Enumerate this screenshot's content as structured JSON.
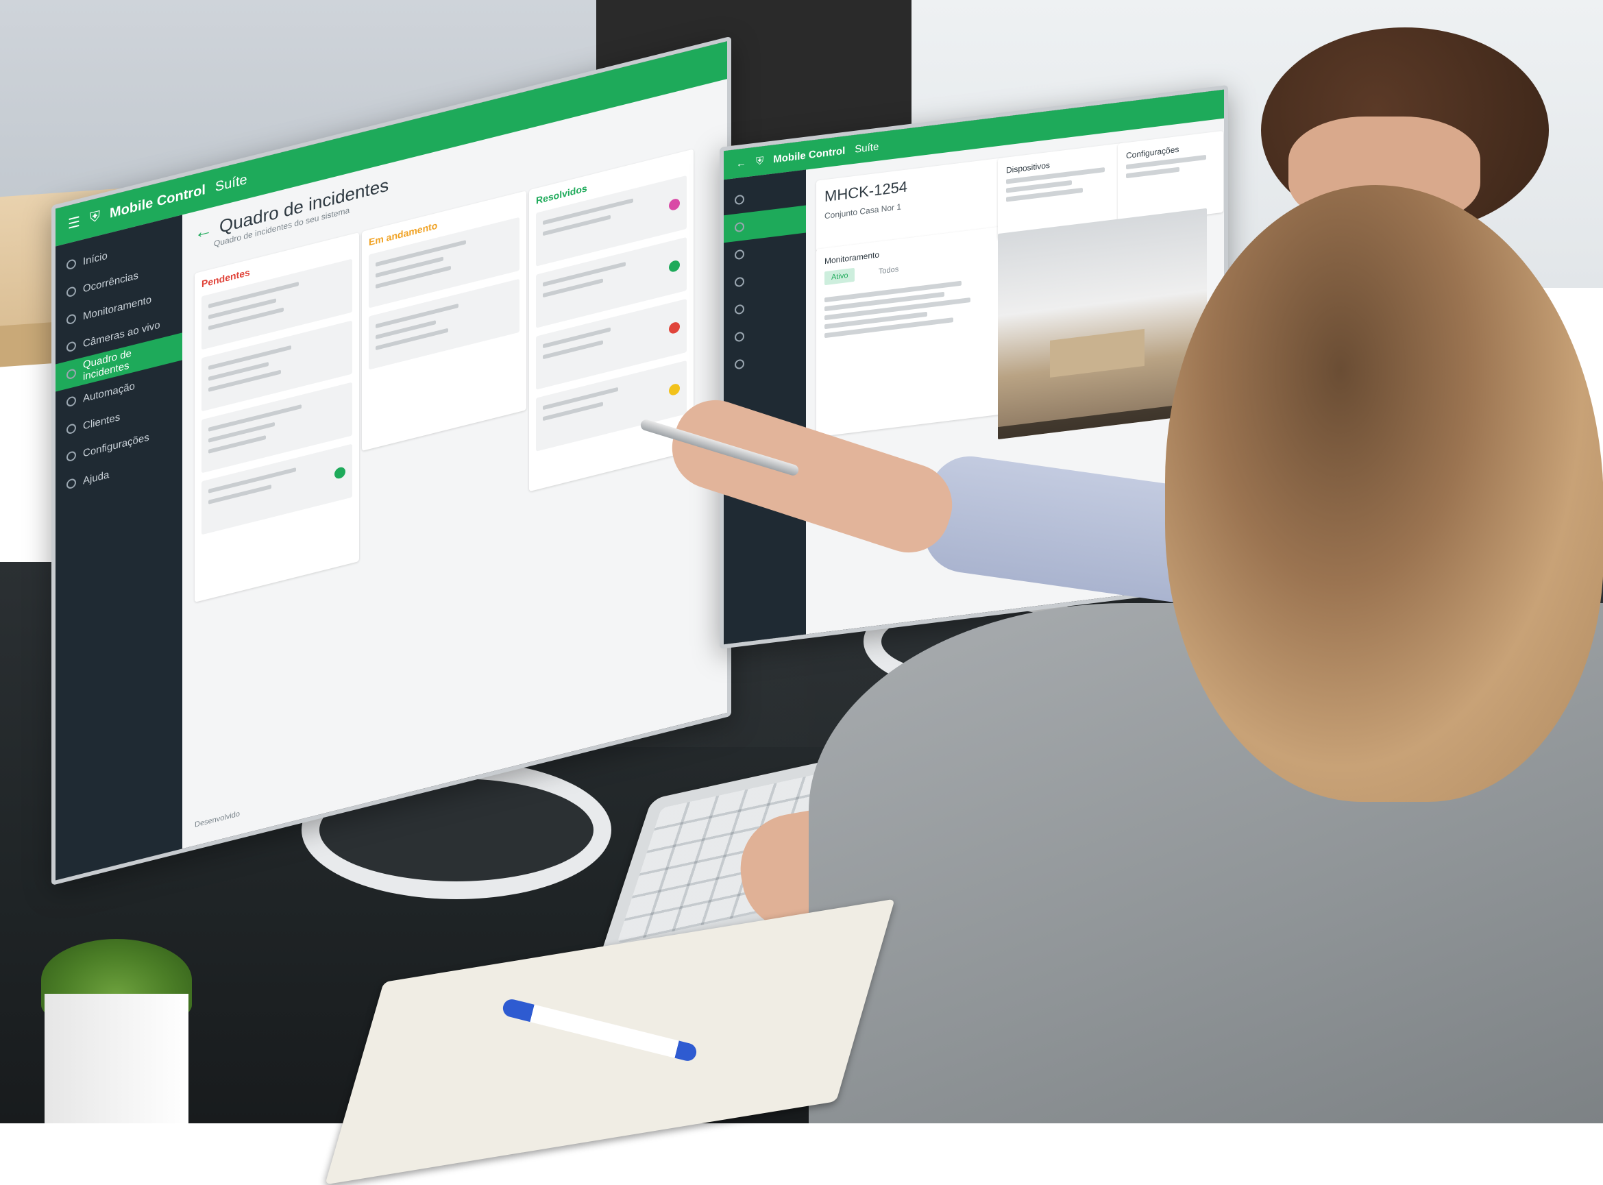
{
  "scene": {
    "description_free": true
  },
  "monitor_left": {
    "app_name": "Mobile Control",
    "app_suffix": "Suíte",
    "page_title": "Quadro de incidentes",
    "page_subtitle": "Quadro de incidentes do seu sistema",
    "sidebar": {
      "items": [
        {
          "label": "Início"
        },
        {
          "label": "Ocorrências"
        },
        {
          "label": "Monitoramento"
        },
        {
          "label": "Câmeras ao vivo"
        },
        {
          "label": "Quadro de incidentes"
        },
        {
          "label": "Automação"
        },
        {
          "label": "Clientes"
        },
        {
          "label": "Configurações"
        },
        {
          "label": "Ajuda"
        }
      ]
    },
    "columns": [
      {
        "label": "Pendentes",
        "color": "#e0443a"
      },
      {
        "label": "Em andamento",
        "color": "#f0a326"
      },
      {
        "label": "Resolvidos",
        "color": "#1eaa5a"
      }
    ],
    "footer_label": "Desenvolvido"
  },
  "monitor_right": {
    "app_name": "Mobile Control",
    "app_suffix": "Suíte",
    "title": "MHCK-1254",
    "subtitle": "Conjunto Casa Nor 1",
    "section_monitoring": "Monitoramento",
    "tab_active": "Ativo",
    "tab_other": "Todos",
    "panel_title_1": "Dispositivos",
    "panel_title_2": "Configurações"
  },
  "colors": {
    "brand_green": "#1eaa5a",
    "sidebar_dark": "#1f2a33",
    "accent_pink": "#d94aa6",
    "accent_yellow": "#f2c21b",
    "accent_red": "#e0443a"
  }
}
